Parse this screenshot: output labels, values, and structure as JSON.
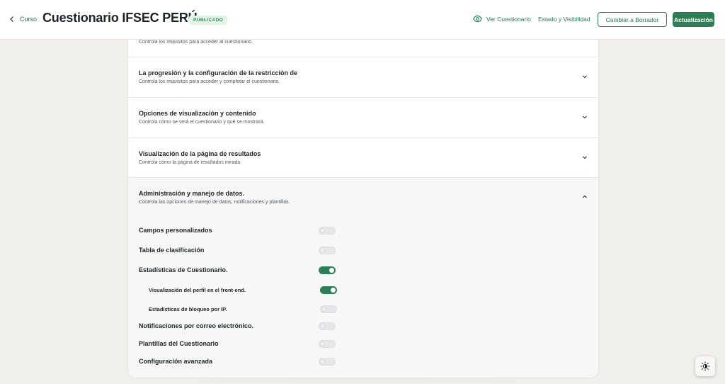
{
  "header": {
    "back_label": "Curso",
    "title": "Cuestionario IFSEC PERÚ",
    "status": "PUBLICADO",
    "view_label": "Ver Cuestionario",
    "visibility_label": "Estado y Visibilidad",
    "draft_label": "Cambiar a Borrador",
    "update_label": "Actualización"
  },
  "sections": [
    {
      "title": "",
      "desc": "Controla los requisitos para acceder al cuestionario."
    },
    {
      "title": "La progresión y la configuración de la restricción de",
      "desc": "Controla los requisitos para acceder y completar el cuestionario."
    },
    {
      "title": "Opciones de visualización y contenido",
      "desc": "Controla cómo se verá el cuestionario y qué se mostrará."
    },
    {
      "title": "Visualización de la página de resultados",
      "desc": "Controla cómo la página de resultados mirada"
    },
    {
      "title": "Administración y manejo de datos.",
      "desc": "Controla las opciones de manejo de datos, notificaciones y plantillas."
    }
  ],
  "options": [
    {
      "label": "Campos personalizados",
      "enabled": false
    },
    {
      "label": "Tabla de clasificación",
      "enabled": false
    },
    {
      "label": "Estadísticas de Cuestionario.",
      "enabled": true
    },
    {
      "label": "Visualización del perfil en el front-end.",
      "enabled": true
    },
    {
      "label": "Estadísticas de bloqueo por IP.",
      "enabled": false
    },
    {
      "label": "Notificaciones por correo electrónico.",
      "enabled": false
    },
    {
      "label": "Plantillas del Cuestionario",
      "enabled": false
    },
    {
      "label": "Configuración avanzada",
      "enabled": false
    }
  ],
  "icons": {
    "back": "chevron-left-icon",
    "view": "eye-icon",
    "collapsed": "chevron-down-icon",
    "expanded": "chevron-up-icon",
    "theme": "sun-icon"
  },
  "colors": {
    "accent": "#2e7d57",
    "accent_text": "#1f7a4d",
    "badge_bg": "#e3f3e8",
    "page_bg": "#f0efea"
  }
}
